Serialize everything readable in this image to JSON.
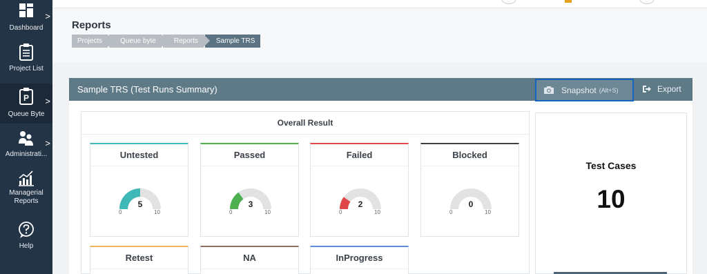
{
  "sidebar": {
    "items": [
      {
        "label": "Dashboard",
        "icon": "dashboard-icon",
        "chevron": ">"
      },
      {
        "label": "Project List",
        "icon": "clipboard-icon",
        "chevron": ""
      },
      {
        "label": "Queue Byte",
        "icon": "queue-byte-icon",
        "chevron": ">"
      },
      {
        "label": "Administrati...",
        "icon": "admin-users-icon",
        "chevron": ">"
      },
      {
        "label": "Managerial Reports",
        "icon": "bar-chart-icon",
        "chevron": ""
      },
      {
        "label": "Help",
        "icon": "help-icon",
        "chevron": ""
      }
    ]
  },
  "page": {
    "title": "Reports",
    "breadcrumb": [
      "Projects",
      "Queue byte",
      "Reports",
      "Sample TRS"
    ]
  },
  "panel": {
    "title": "Sample TRS (Test Runs Summary)",
    "snapshot_label": "Snapshot",
    "snapshot_shortcut": "(Alt+S)",
    "export_label": "Export"
  },
  "overall": {
    "title": "Overall Result",
    "gauge_min": "0",
    "gauge_max": "10",
    "statuses": [
      {
        "label": "Untested",
        "value": 5,
        "max": 10,
        "color": "#3fb8b8"
      },
      {
        "label": "Passed",
        "value": 3,
        "max": 10,
        "color": "#4caf50"
      },
      {
        "label": "Failed",
        "value": 2,
        "max": 10,
        "color": "#e04848"
      },
      {
        "label": "Blocked",
        "value": 0,
        "max": 10,
        "color": "#3a3f44"
      },
      {
        "label": "Retest",
        "value": null,
        "max": 10,
        "color": "#f0b45a"
      },
      {
        "label": "NA",
        "value": null,
        "max": 10,
        "color": "#8d6e63"
      },
      {
        "label": "InProgress",
        "value": null,
        "max": 10,
        "color": "#5c8fd6"
      }
    ]
  },
  "test_cases": {
    "label": "Test Cases",
    "count": "10"
  },
  "colors": {
    "sidebar_bg": "#243447",
    "panel_header_bg": "#5f7a87",
    "snapshot_highlight": "#1565c0",
    "gauge_track": "#e2e2e2"
  }
}
